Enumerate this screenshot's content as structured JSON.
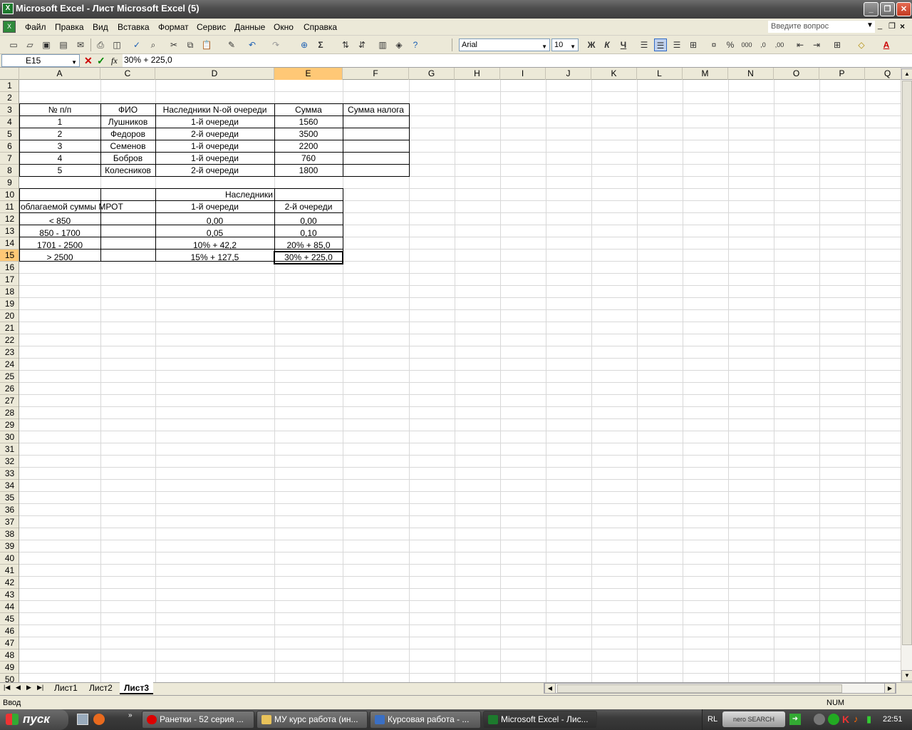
{
  "window": {
    "title": "Microsoft Excel - Лист Microsoft Excel (5)",
    "min_glyph": "_",
    "max_glyph": "❐",
    "close_glyph": "✕"
  },
  "menu": {
    "items": [
      "Файл",
      "Правка",
      "Вид",
      "Вставка",
      "Формат",
      "Сервис",
      "Данные",
      "Окно",
      "Справка"
    ],
    "help_placeholder": "Введите вопрос"
  },
  "toolbar": {
    "font": "Arial",
    "size": "10",
    "bold": "Ж",
    "italic": "К",
    "underline": "Ч"
  },
  "formula_bar": {
    "name_box": "E15",
    "formula": "30% + 225,0",
    "fx": "fx"
  },
  "columns": [
    "A",
    "C",
    "D",
    "E",
    "F",
    "G",
    "H",
    "I",
    "J",
    "K",
    "L",
    "M",
    "N",
    "O",
    "P",
    "Q"
  ],
  "rows": [
    "1",
    "2",
    "3",
    "4",
    "5",
    "6",
    "7",
    "8",
    "9",
    "10",
    "11",
    "12",
    "13",
    "14",
    "15",
    "16",
    "17",
    "18",
    "19",
    "20",
    "21",
    "22",
    "23",
    "24",
    "25",
    "26",
    "27",
    "28",
    "29",
    "30",
    "31",
    "32",
    "33",
    "34",
    "35",
    "36",
    "37",
    "38",
    "39",
    "40",
    "41",
    "42",
    "43",
    "44",
    "45",
    "46",
    "47",
    "48",
    "49",
    "50"
  ],
  "table1": {
    "headers": [
      "№ п/п",
      "ФИО",
      "Наследники N-ой очереди",
      "Сумма",
      "Сумма налога"
    ],
    "rows": [
      [
        "1",
        "Лушников",
        "1-й очереди",
        "1560",
        ""
      ],
      [
        "2",
        "Федоров",
        "2-й очереди",
        "3500",
        ""
      ],
      [
        "3",
        "Семенов",
        "1-й очереди",
        "2200",
        ""
      ],
      [
        "4",
        "Бобров",
        "1-й очереди",
        "760",
        ""
      ],
      [
        "5",
        "Колесников",
        "2-й очереди",
        "1800",
        ""
      ]
    ]
  },
  "table2": {
    "group_header": "Наследники",
    "col_a_header": "облагаемой суммы МРОТ",
    "col_d_header": "1-й очереди",
    "col_e_header": "2-й очереди",
    "rows": [
      [
        "< 850",
        "0,00",
        "0,00"
      ],
      [
        "850 - 1700",
        "0,05",
        "0,10"
      ],
      [
        "1701 - 2500",
        "10% + 42,2",
        "20% + 85,0"
      ],
      [
        "> 2500",
        "15% + 127,5",
        "30% + 225,0"
      ]
    ]
  },
  "sheets": {
    "tabs": [
      "Лист1",
      "Лист2",
      "Лист3"
    ],
    "active": "Лист3"
  },
  "status": {
    "mode": "Ввод",
    "num": "NUM"
  },
  "taskbar": {
    "start": "пуск",
    "tasks": [
      "Ранетки - 52 серия ...",
      "МУ курс работа (ин...",
      "Курсовая работа - ...",
      "Microsoft Excel - Лис..."
    ],
    "lang": "RL",
    "search": "nero SEARCH",
    "clock": "22:51"
  },
  "colors": {
    "selection_header": "#ffc876",
    "title_gradient": "#4d4d4d",
    "accent_excel": "#1d7a2d"
  }
}
